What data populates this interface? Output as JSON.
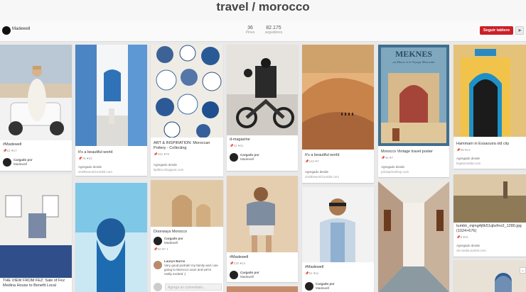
{
  "board": {
    "title": "travel / morocco",
    "owner": "Madewell",
    "pins_count": "36",
    "pins_label": "Pines",
    "followers_count": "82.175",
    "followers_label": "seguidores",
    "follow_button": "Seguir tablero",
    "send_icon": "paper-plane-icon"
  },
  "pins": [
    {
      "desc": "#Madewell",
      "repins": "51",
      "likes": "17",
      "uploaded_label": "Cargado por",
      "uploader": "Madewell"
    },
    {
      "desc": "It's a beautiful world",
      "repins": "76",
      "likes": "15",
      "source_label": "Agregado desde",
      "source_url": "visittheworld.tumblr.com"
    },
    {
      "desc": "ART & INSPIRATION: Moroccan Pottery - Collecting",
      "repins": "331",
      "likes": "70",
      "source_label": "Agregado desde",
      "source_url": "kiplbeo.blogspot.com"
    },
    {
      "desc": "d-magazine",
      "repins": "31",
      "likes": "11",
      "uploaded_label": "Cargado por",
      "uploader": "Madewell"
    },
    {
      "desc": "It's a beautiful world",
      "repins": "142",
      "likes": "7",
      "source_label": "Agregado desde",
      "source_url": "visittheworld.tumblr.com"
    },
    {
      "desc": "Morocco Vintage travel poster",
      "repins": "45",
      "likes": "7",
      "source_label": "Agregado desde",
      "source_url": "printsprintshop.com"
    },
    {
      "desc": "Hammam in Essaouira old city",
      "repins": "69",
      "likes": "13",
      "source_label": "Agregado desde",
      "source_url": "legatomedia.com"
    },
    {
      "desc": "THE VIEW FROM FEZ: Sale of Fez Medina House to Benefit Local",
      "repins": "",
      "likes": ""
    },
    {
      "desc": "",
      "repins": "",
      "likes": ""
    },
    {
      "desc": "Doorways Morocco",
      "repins": "32",
      "likes": "7",
      "likes_extra": "1",
      "uploaded_label": "Cargado por",
      "uploader": "Madewell",
      "comment_user": "Lauryn Burns",
      "comment_text": "Very good portrait! my family and i are going to Morocco soon and we're really excited :)",
      "comment_placeholder": "Agrega un comentario..."
    },
    {
      "desc": "#Madewell",
      "repins": "120",
      "likes": "14",
      "uploaded_label": "Cargado por",
      "uploader": "Madewell"
    },
    {
      "desc": "#Madewell",
      "repins": "51",
      "likes": "11",
      "uploaded_label": "Cargado por",
      "uploader": "Madewell"
    },
    {
      "desc": "",
      "repins": "",
      "likes": ""
    },
    {
      "desc": "tumblr_mjmg4j6k51qbzfno2_1280.jpg (1024×676)",
      "repins": "9",
      "likes": "11",
      "source_label": "Agregado desde",
      "source_url": "25.media.tumblr.com"
    },
    {
      "desc": "",
      "repins": "",
      "likes": ""
    }
  ],
  "images": {
    "poster_title": "MEKNES",
    "poster_sub": "au Maroc et le Voyage Marocain"
  },
  "icons": {
    "repin": "pushpin-icon",
    "like": "heart-icon",
    "scroll": "chevron-down-icon"
  }
}
